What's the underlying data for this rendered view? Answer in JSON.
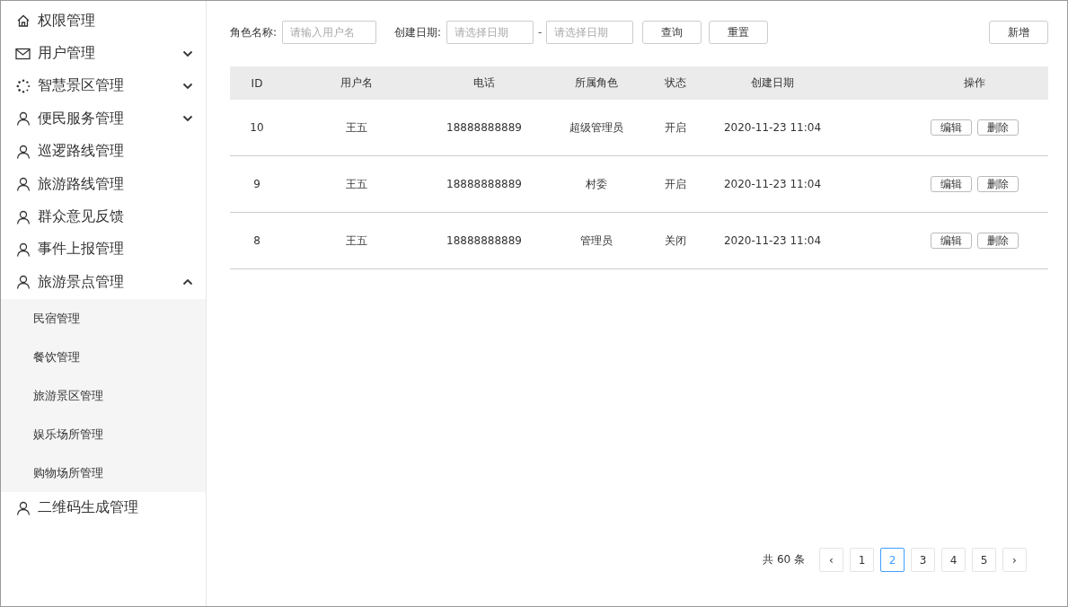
{
  "sidebar": {
    "items": [
      {
        "label": "权限管理",
        "selected": false
      },
      {
        "label": "用户管理",
        "selected": false,
        "expanded": false
      },
      {
        "label": "智慧景区管理",
        "selected": false,
        "expanded": false
      },
      {
        "label": "便民服务管理",
        "selected": false,
        "expanded": false
      },
      {
        "label": "巡逻路线管理",
        "selected": false
      },
      {
        "label": "旅游路线管理",
        "selected": false
      },
      {
        "label": "群众意见反馈",
        "selected": false
      },
      {
        "label": "事件上报管理",
        "selected": false
      },
      {
        "label": "旅游景点管理",
        "selected": false,
        "expanded": true,
        "children": [
          {
            "label": "民宿管理",
            "selected": false
          },
          {
            "label": "餐饮管理",
            "selected": false
          },
          {
            "label": "旅游景区管理",
            "selected": false
          },
          {
            "label": "娱乐场所管理",
            "selected": false
          },
          {
            "label": "购物场所管理",
            "selected": false
          }
        ]
      },
      {
        "label": "二维码生成管理",
        "selected": false
      }
    ]
  },
  "filters": {
    "role_label": "角色名称:",
    "role_placeholder": "请输入用户名",
    "date_label": "创建日期:",
    "start_placeholder": "请选择日期",
    "separator": "-",
    "end_placeholder": "请选择日期",
    "buttons": [
      "查询",
      "重置"
    ],
    "add_button": "新增"
  },
  "table": {
    "columns": [
      "ID",
      "用户名",
      "电话",
      "所属角色",
      "状态",
      "创建日期",
      "操作"
    ],
    "rows": [
      {
        "cells": [
          "10",
          "王五",
          "18888888889",
          "超级管理员",
          "开启",
          "2020-11-23 11:04"
        ],
        "actions": [
          "编辑",
          "删除"
        ]
      },
      {
        "cells": [
          "9",
          "王五",
          "18888888889",
          "村委",
          "开启",
          "2020-11-23 11:04"
        ],
        "actions": [
          "编辑",
          "删除"
        ]
      },
      {
        "cells": [
          "8",
          "王五",
          "18888888889",
          "管理员",
          "关闭",
          "2020-11-23 11:04"
        ],
        "actions": [
          "编辑",
          "删除"
        ]
      }
    ]
  },
  "pagination": {
    "total": "共 60 条",
    "prev": "‹",
    "next": "›",
    "pages": [
      {
        "label": "1",
        "selected": false
      },
      {
        "label": "2",
        "selected": true
      },
      {
        "label": "3",
        "selected": false
      },
      {
        "label": "4",
        "selected": false
      },
      {
        "label": "5",
        "selected": false
      }
    ]
  }
}
